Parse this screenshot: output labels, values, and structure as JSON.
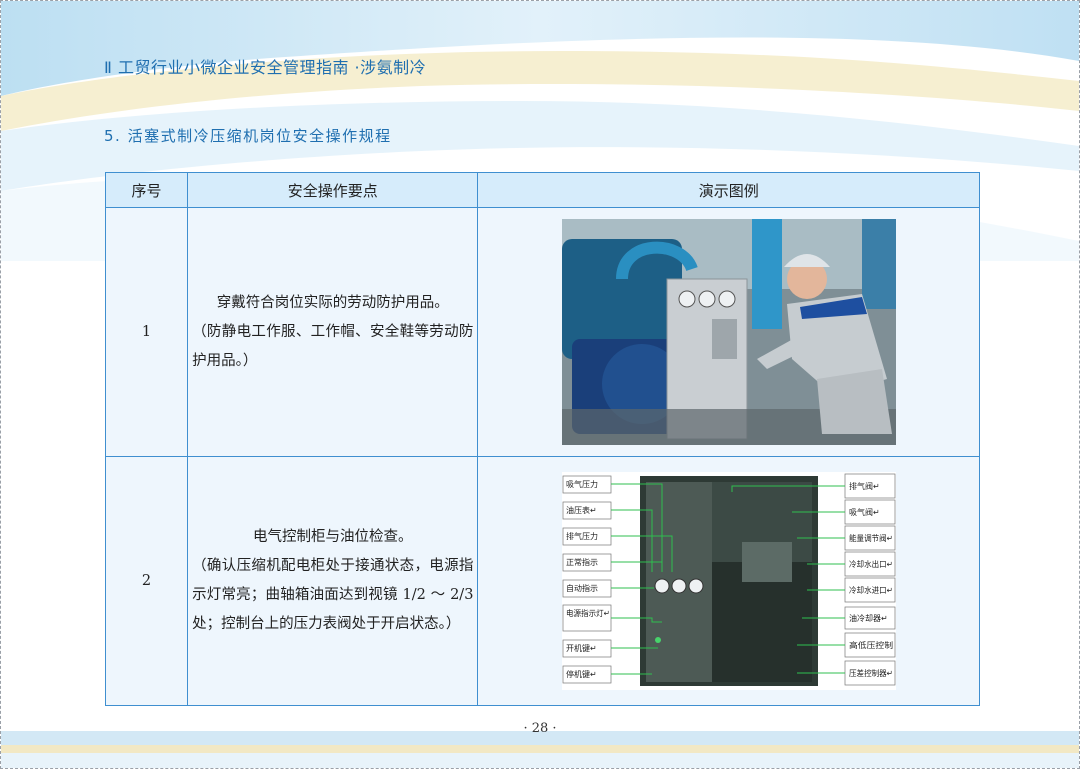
{
  "header": {
    "title": "Ⅱ 工贸行业小微企业安全管理指南 ·涉氨制冷"
  },
  "section": {
    "title": "5. 活塞式制冷压缩机岗位安全操作规程"
  },
  "table": {
    "headers": [
      "序号",
      "安全操作要点",
      "演示图例"
    ],
    "rows": [
      {
        "number": "1",
        "main": "穿戴符合岗位实际的劳动防护用品。",
        "note": "（防静电工作服、工作帽、安全鞋等劳动防护用品。）"
      },
      {
        "number": "2",
        "main": "电气控制柜与油位检查。",
        "note": "（确认压缩机配电柜处于接通状态，电源指示灯常亮；曲轴箱油面达到视镜 1/2 ～ 2/3 处；控制台上的压力表阀处于开启状态。）"
      }
    ]
  },
  "diagram": {
    "left_labels": [
      "吸气压力",
      "油压表↵",
      "排气压力",
      "正常指示",
      "自动指示",
      "电源指示灯↵",
      "开机键↵",
      "停机键↵"
    ],
    "right_labels": [
      "排气阀↵",
      "吸气阀↵",
      "能量调节阀↵",
      "冷却水出口↵",
      "冷却水进口↵",
      "油冷却器↵",
      "高低压控制",
      "压差控制器↵"
    ]
  },
  "footer": {
    "page_number": "· 28 ·"
  },
  "colors": {
    "accent": "#1f6fb0",
    "table_border": "#3f8fd0",
    "header_fill": "#d6ecfb",
    "cell_fill": "#eef6fd"
  }
}
